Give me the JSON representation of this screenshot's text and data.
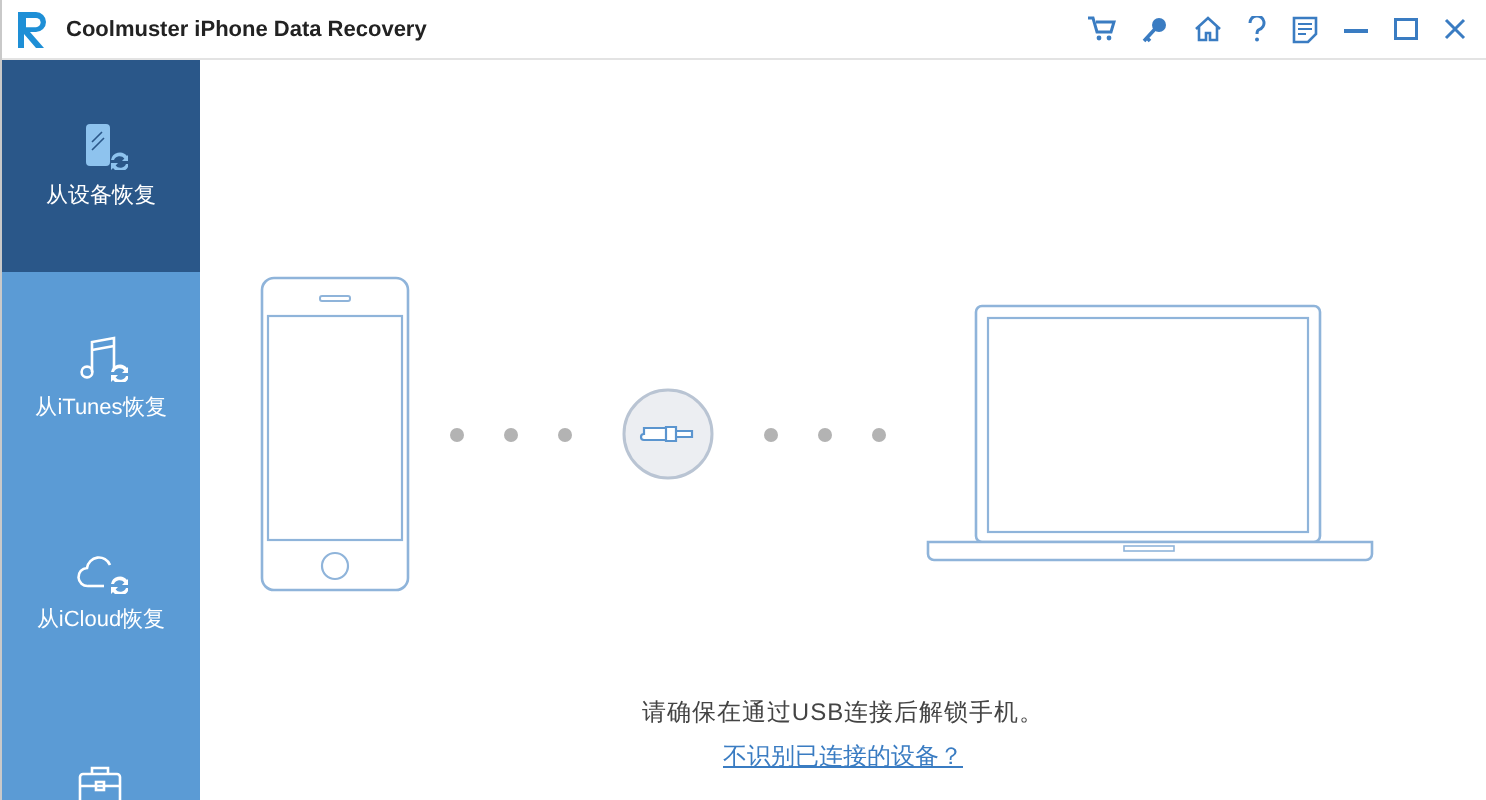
{
  "window": {
    "title": "Coolmuster iPhone Data Recovery"
  },
  "sidebar": {
    "items": [
      {
        "kind": "device",
        "label": "从设备恢复",
        "selected": true
      },
      {
        "kind": "itunes",
        "label": "从iTunes恢复",
        "selected": false
      },
      {
        "kind": "icloud",
        "label": "从iCloud恢复",
        "selected": false
      },
      {
        "kind": "toolkit",
        "selected": false
      }
    ]
  },
  "main": {
    "instruction": "请确保在通过USB连接后解锁手机。",
    "help_link": "不识别已连接的设备？"
  }
}
